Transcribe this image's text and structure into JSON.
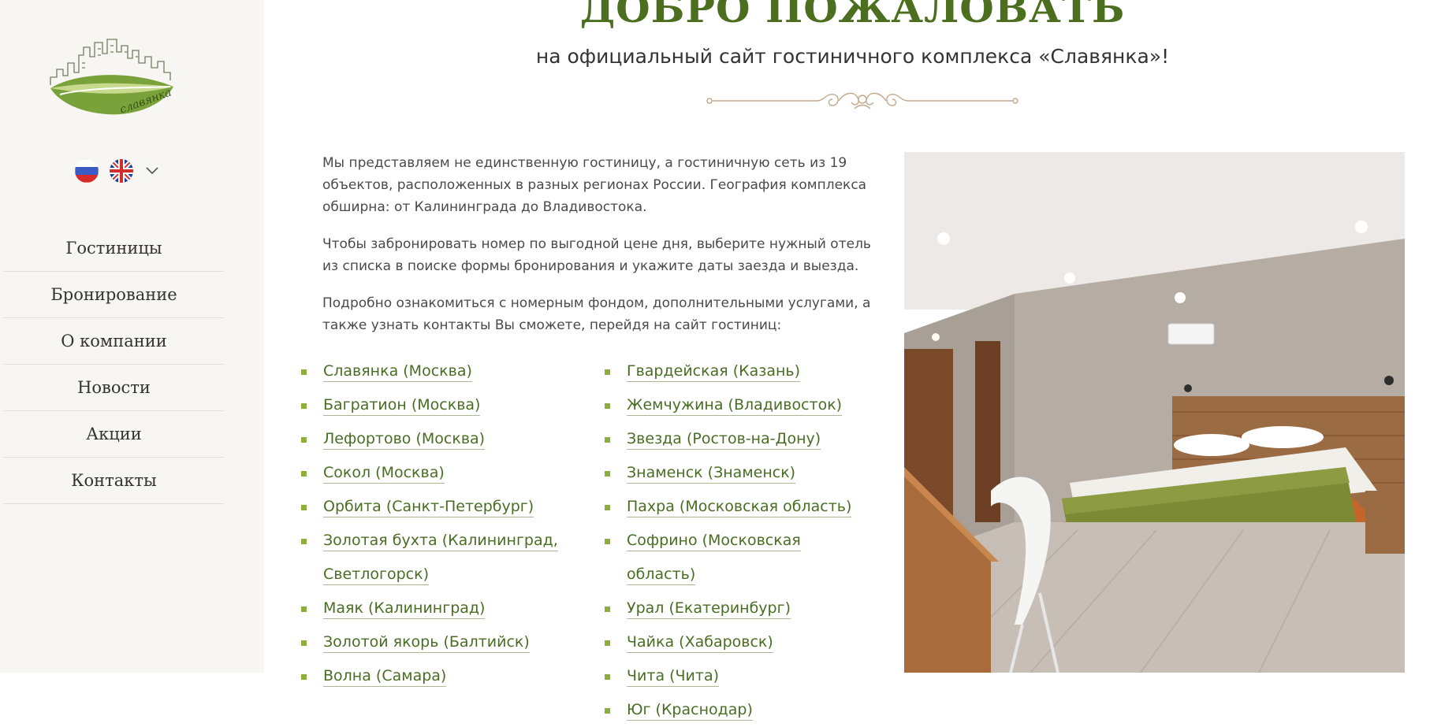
{
  "sidebar": {
    "logo_text": "славянка",
    "languages": [
      "Русский",
      "English"
    ],
    "menu": [
      "Гостиницы",
      "Бронирование",
      "О компании",
      "Новости",
      "Акции",
      "Контакты"
    ]
  },
  "header": {
    "title": "ДОБРО ПОЖАЛОВАТЬ",
    "subtitle": "на официальный сайт гостиничного комплекса «Славянка»!"
  },
  "intro": [
    "Мы представляем не единственную гостиницу, а гостиничную сеть из 19 объектов, расположенных в разных регионах России. География комплекса обширна: от Калининграда до Владивостока.",
    "Чтобы забронировать номер по выгодной цене дня, выберите нужный отель из списка в поиске формы бронирования и укажите даты заезда и выезда.",
    "Подробно ознакомиться с номерным фондом, дополнительными услугами, а также узнать контакты Вы сможете, перейдя на сайт гостиниц:"
  ],
  "hotels_left": [
    "Славянка (Москва)",
    "Багратион (Москва)",
    "Лефортово (Москва)",
    "Сокол (Москва)",
    "Орбита (Санкт-Петербург)",
    "Золотая бухта (Калининград, Светлогорск)",
    "Маяк (Калининград)",
    "Золотой якорь (Балтийск)",
    "Волна (Самара)"
  ],
  "hotels_right": [
    "Гвардейская (Казань)",
    "Жемчужина (Владивосток)",
    "Звезда (Ростов-на-Дону)",
    "Знаменск (Знаменск)",
    "Пахра (Московская область)",
    "Софрино (Московская область)",
    "Урал (Екатеринбург)",
    "Чайка (Хабаровск)",
    "Чита (Чита)",
    "Юг (Краснодар)"
  ],
  "colors": {
    "accent_green": "#4b6e1f",
    "bullet": "#8cae3b",
    "sidebar_bg": "#f8f6f3"
  }
}
